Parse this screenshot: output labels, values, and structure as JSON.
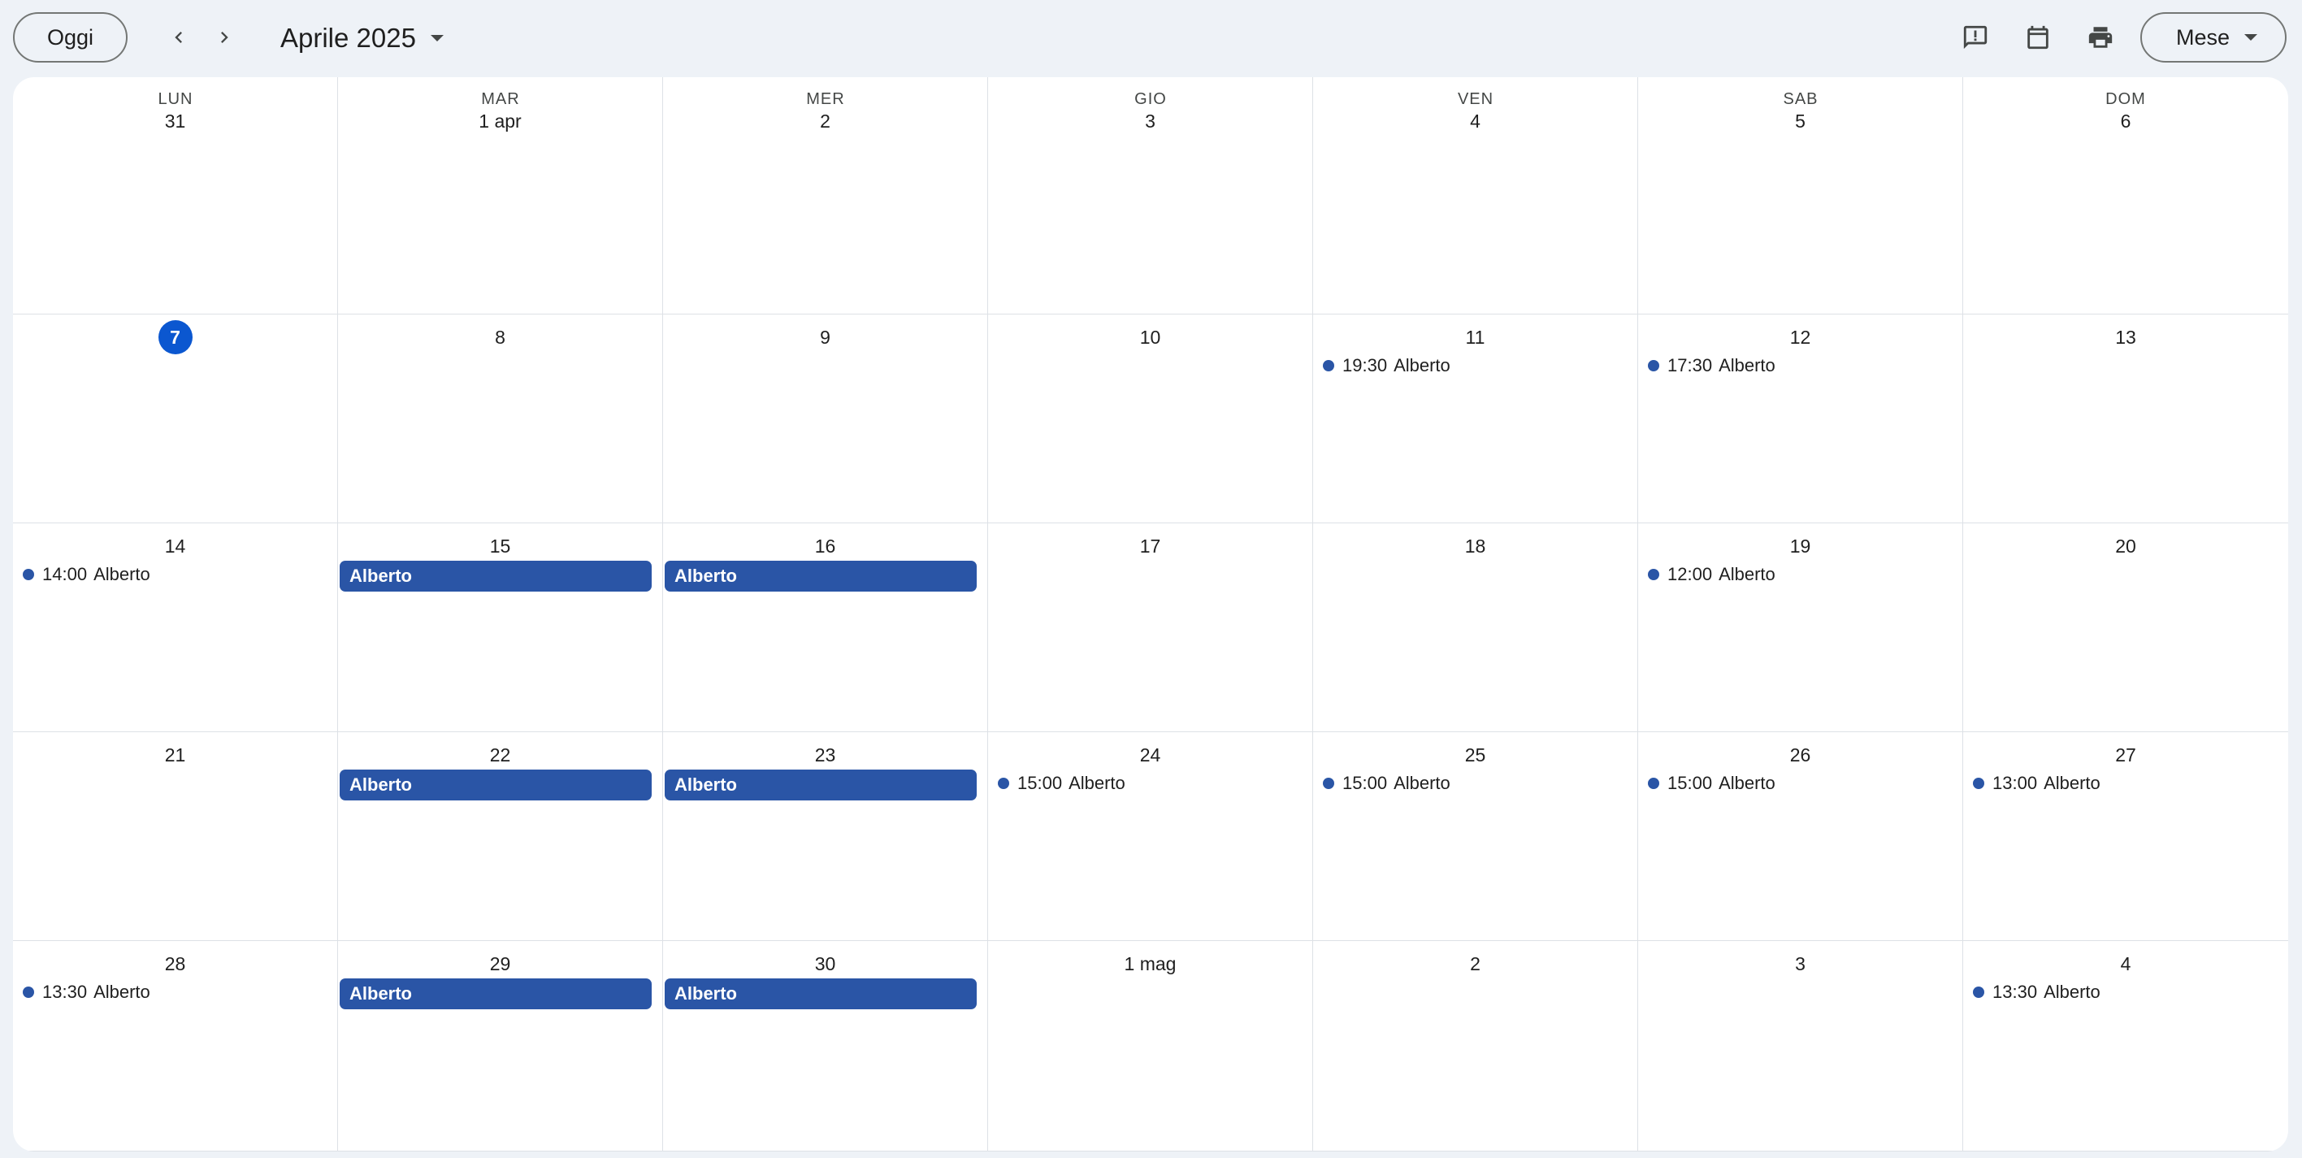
{
  "toolbar": {
    "today_label": "Oggi",
    "month_label": "Aprile 2025",
    "view_label": "Mese",
    "icons": [
      "chevron-left-icon",
      "chevron-right-icon",
      "feedback-icon",
      "calendar-icon",
      "print-icon"
    ]
  },
  "weekdays": [
    "LUN",
    "MAR",
    "MER",
    "GIO",
    "VEN",
    "SAB",
    "DOM"
  ],
  "colors": {
    "accent": "#0b57d0",
    "event": "#2a55a6"
  },
  "weeks": [
    {
      "days": [
        {
          "label": "31",
          "events": []
        },
        {
          "label": "1 apr",
          "events": []
        },
        {
          "label": "2",
          "events": []
        },
        {
          "label": "3",
          "events": []
        },
        {
          "label": "4",
          "events": []
        },
        {
          "label": "5",
          "events": []
        },
        {
          "label": "6",
          "events": []
        }
      ]
    },
    {
      "days": [
        {
          "label": "7",
          "today": true,
          "events": []
        },
        {
          "label": "8",
          "events": []
        },
        {
          "label": "9",
          "events": []
        },
        {
          "label": "10",
          "events": []
        },
        {
          "label": "11",
          "events": [
            {
              "type": "timed",
              "time": "19:30",
              "title": "Alberto"
            }
          ]
        },
        {
          "label": "12",
          "events": [
            {
              "type": "timed",
              "time": "17:30",
              "title": "Alberto"
            }
          ]
        },
        {
          "label": "13",
          "events": []
        }
      ]
    },
    {
      "days": [
        {
          "label": "14",
          "events": [
            {
              "type": "timed",
              "time": "14:00",
              "title": "Alberto"
            }
          ]
        },
        {
          "label": "15",
          "events": [
            {
              "type": "allday",
              "title": "Alberto"
            }
          ]
        },
        {
          "label": "16",
          "events": [
            {
              "type": "allday",
              "title": "Alberto"
            }
          ]
        },
        {
          "label": "17",
          "events": []
        },
        {
          "label": "18",
          "events": []
        },
        {
          "label": "19",
          "events": [
            {
              "type": "timed",
              "time": "12:00",
              "title": "Alberto"
            }
          ]
        },
        {
          "label": "20",
          "events": []
        }
      ]
    },
    {
      "days": [
        {
          "label": "21",
          "events": []
        },
        {
          "label": "22",
          "events": [
            {
              "type": "allday",
              "title": "Alberto"
            }
          ]
        },
        {
          "label": "23",
          "events": [
            {
              "type": "allday",
              "title": "Alberto"
            }
          ]
        },
        {
          "label": "24",
          "events": [
            {
              "type": "timed",
              "time": "15:00",
              "title": "Alberto"
            }
          ]
        },
        {
          "label": "25",
          "events": [
            {
              "type": "timed",
              "time": "15:00",
              "title": "Alberto"
            }
          ]
        },
        {
          "label": "26",
          "events": [
            {
              "type": "timed",
              "time": "15:00",
              "title": "Alberto"
            }
          ]
        },
        {
          "label": "27",
          "events": [
            {
              "type": "timed",
              "time": "13:00",
              "title": "Alberto"
            }
          ]
        }
      ]
    },
    {
      "days": [
        {
          "label": "28",
          "events": [
            {
              "type": "timed",
              "time": "13:30",
              "title": "Alberto"
            }
          ]
        },
        {
          "label": "29",
          "events": [
            {
              "type": "allday",
              "title": "Alberto"
            }
          ]
        },
        {
          "label": "30",
          "events": [
            {
              "type": "allday",
              "title": "Alberto"
            }
          ]
        },
        {
          "label": "1 mag",
          "events": []
        },
        {
          "label": "2",
          "events": []
        },
        {
          "label": "3",
          "events": []
        },
        {
          "label": "4",
          "events": [
            {
              "type": "timed",
              "time": "13:30",
              "title": "Alberto"
            }
          ]
        }
      ]
    }
  ]
}
